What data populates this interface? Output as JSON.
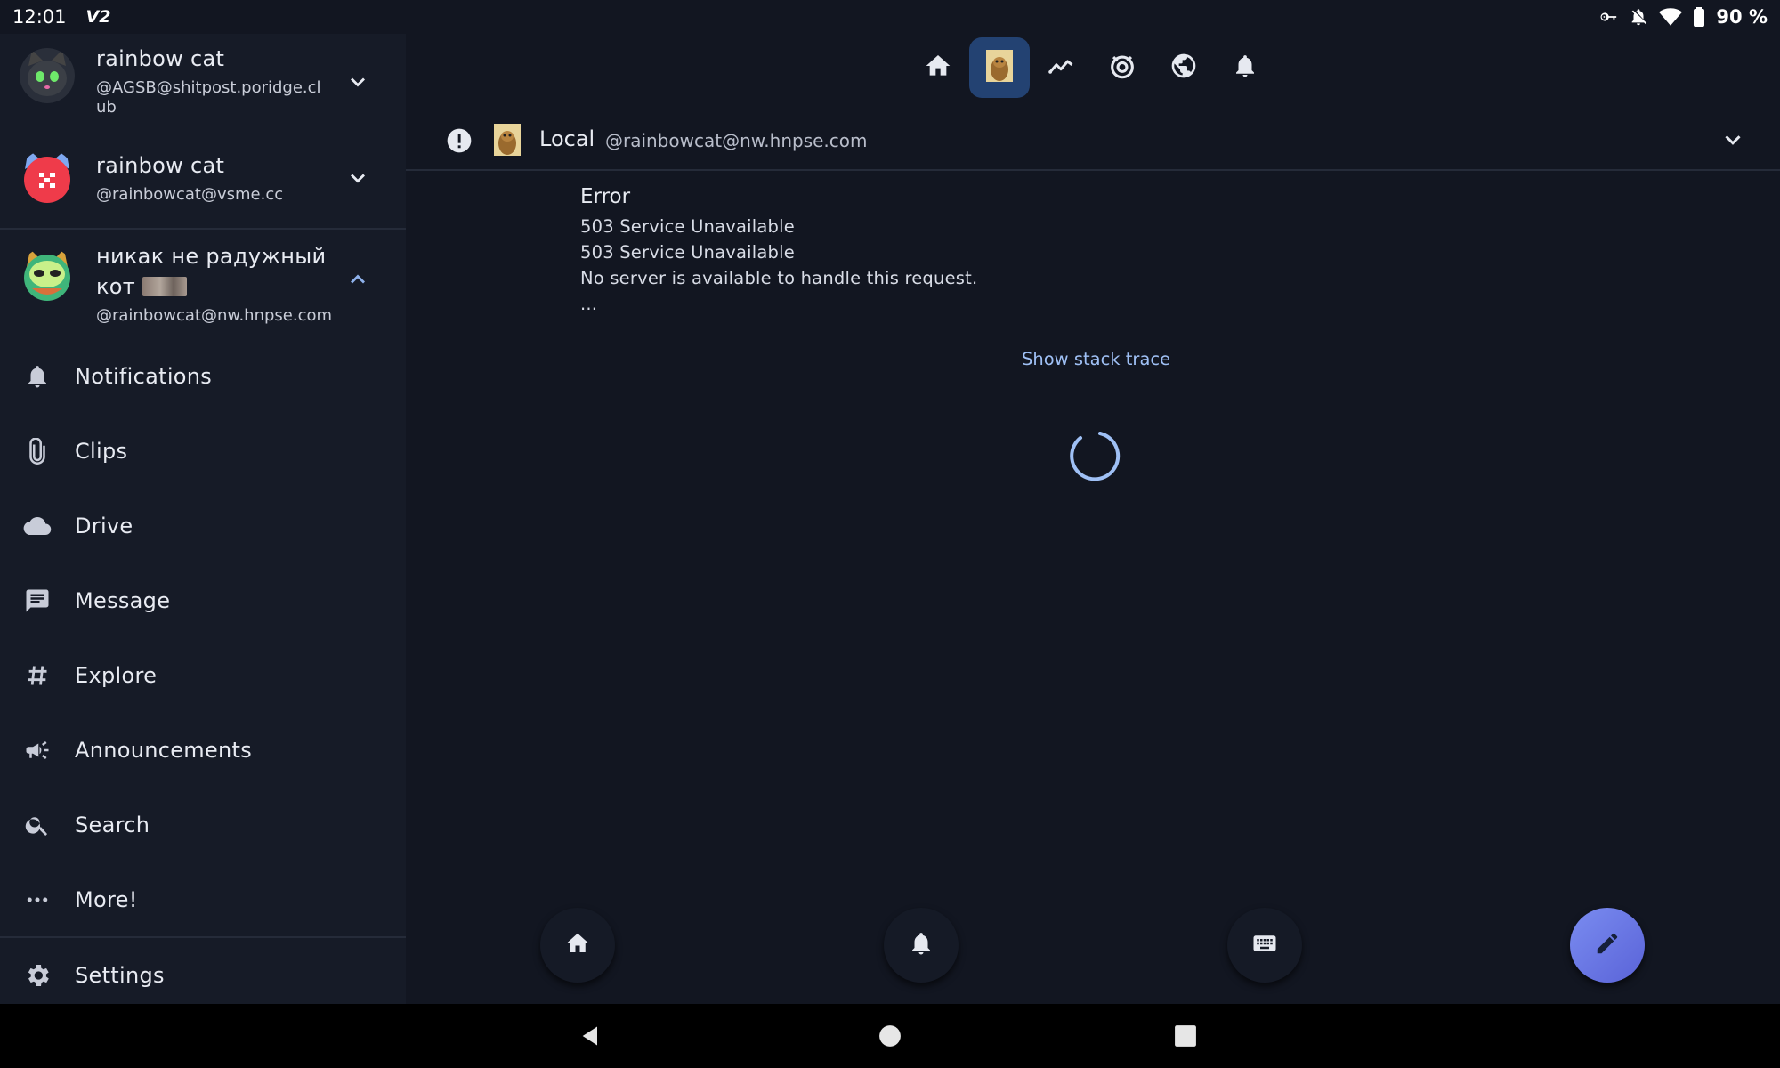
{
  "status_bar": {
    "time": "12:01",
    "carrier": "V2",
    "battery": "90 %"
  },
  "accounts": [
    {
      "name": "rainbow cat",
      "handle_line1": "@AGSB@shitpost.poridge.cl",
      "handle_line2": "ub"
    },
    {
      "name": "rainbow cat",
      "handle": "@rainbowcat@vsme.cc"
    },
    {
      "name_line1": "никак не радужный",
      "name_line2": "кот",
      "handle": "@rainbowcat@nw.hnpse.com"
    }
  ],
  "menu": {
    "notifications": "Notifications",
    "clips": "Clips",
    "drive": "Drive",
    "message": "Message",
    "explore": "Explore",
    "announcements": "Announcements",
    "search": "Search",
    "more": "More!",
    "settings": "Settings"
  },
  "timeline": {
    "title": "Local",
    "handle": "@rainbowcat@nw.hnpse.com"
  },
  "error": {
    "title": "Error",
    "lines": [
      "503 Service Unavailable",
      "503 Service Unavailable",
      "No server is available to handle this request.",
      "..."
    ],
    "stack_link": "Show stack trace"
  },
  "colors": {
    "accent": "#9fc0f5",
    "active_tab": "#234272",
    "background": "#121621",
    "sidebar": "#161b27"
  }
}
